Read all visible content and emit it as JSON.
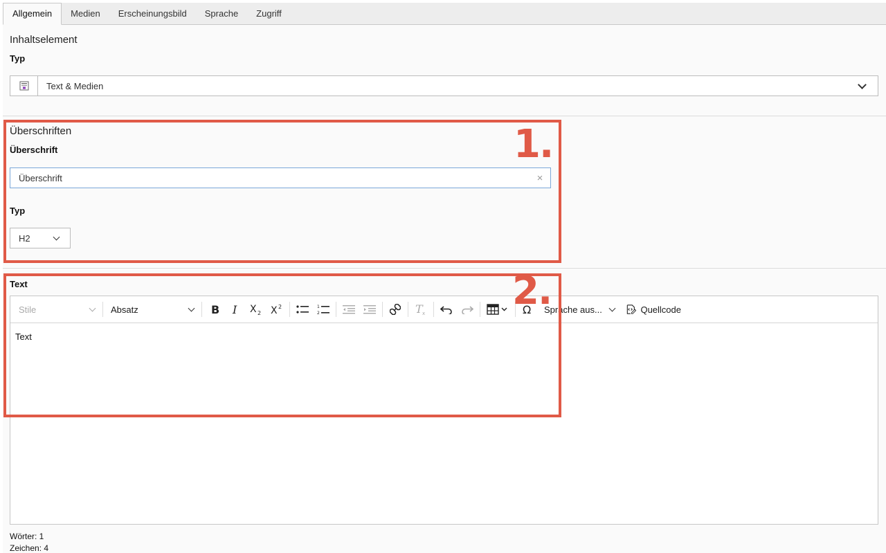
{
  "tabs": [
    "Allgemein",
    "Medien",
    "Erscheinungsbild",
    "Sprache",
    "Zugriff"
  ],
  "content_element": {
    "section_title": "Inhaltselement",
    "type_label": "Typ",
    "type_value": "Text & Medien"
  },
  "headings": {
    "section_title": "Überschriften",
    "heading_label": "Überschrift",
    "heading_value": "Überschrift",
    "clear_icon": "×",
    "type_label": "Typ",
    "type_value": "H2"
  },
  "text_section": {
    "label": "Text",
    "toolbar": {
      "style_dropdown": "Stile",
      "format_dropdown": "Absatz",
      "language_dropdown": "Sprache aus...",
      "source_button": "Quellcode"
    },
    "editor_content": "Text",
    "word_count": "Wörter: 1",
    "char_count": "Zeichen: 4"
  },
  "annotations": {
    "marker_1": "1.",
    "marker_2": "2."
  },
  "colors": {
    "annotation_red": "#e05a47",
    "input_focus_border": "#7aa7d8",
    "panel_bg": "#fafafa",
    "tab_bar_bg": "#ededed"
  }
}
